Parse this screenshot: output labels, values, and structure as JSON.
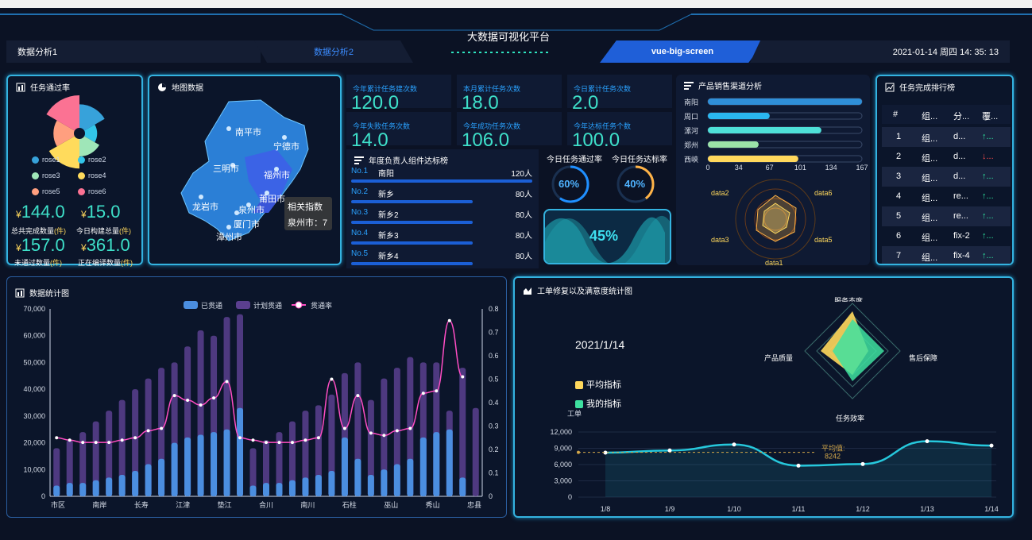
{
  "header": {
    "title": "大数据可视化平台",
    "tabs": [
      "数据分析1",
      "数据分析2",
      "vue-big-screen"
    ],
    "datetime": "2021-01-14 周四 14: 35: 13"
  },
  "task_pass": {
    "title": "任务通过率",
    "legend": [
      "rose1",
      "rose2",
      "rose3",
      "rose4",
      "rose5",
      "rose6"
    ],
    "legend_colors": [
      "#37a2da",
      "#32c5e9",
      "#9fe6b8",
      "#ffdb5c",
      "#ff9f7f",
      "#fb7293"
    ],
    "rose_values": [
      30,
      15,
      22,
      38,
      26,
      42
    ],
    "items": [
      {
        "value": "144.0",
        "label": "总共完成数量",
        "unit": "(件)"
      },
      {
        "value": "15.0",
        "label": "今日构建总量",
        "unit": "(件)"
      },
      {
        "value": "157.0",
        "label": "未通过数量",
        "unit": "(件)"
      },
      {
        "value": "361.0",
        "label": "正在编译数量",
        "unit": "(件)"
      }
    ],
    "currency": "¥"
  },
  "map": {
    "title": "地图数据",
    "cities": [
      "南平市",
      "宁德市",
      "三明市",
      "福州市",
      "莆田市",
      "龙岩市",
      "泉州市",
      "厦门市",
      "漳州市"
    ],
    "tooltip_title": "相关指数",
    "tooltip_value": "泉州市：7"
  },
  "stats": [
    {
      "label": "今年累计任务建次数",
      "value": "120.0"
    },
    {
      "label": "本月累计任务次数",
      "value": "18.0"
    },
    {
      "label": "今日累计任务次数",
      "value": "2.0"
    },
    {
      "label": "今年失败任务次数",
      "value": "14.0"
    },
    {
      "label": "今年成功任务次数",
      "value": "106.0"
    },
    {
      "label": "今年达标任务个数",
      "value": "100.0"
    }
  ],
  "ranking": {
    "title": "年度负责人组件达标榜",
    "rows": [
      {
        "no": "No.1",
        "name": "南阳",
        "count": "120人",
        "ratio": 1.0
      },
      {
        "no": "No.2",
        "name": "新乡",
        "count": "80人",
        "ratio": 0.67
      },
      {
        "no": "No.3",
        "name": "新乡2",
        "count": "80人",
        "ratio": 0.67
      },
      {
        "no": "No.4",
        "name": "新乡3",
        "count": "80人",
        "ratio": 0.67
      },
      {
        "no": "No.5",
        "name": "新乡4",
        "count": "80人",
        "ratio": 0.67
      }
    ]
  },
  "rates": {
    "pass_label": "今日任务通过率",
    "pass_value": "60%",
    "pass_fraction": 0.6,
    "reach_label": "今日任务达标率",
    "reach_value": "40%",
    "reach_fraction": 0.4,
    "wave_value": "45%",
    "wave_fraction": 0.45
  },
  "channel": {
    "title": "产品销售渠道分析",
    "bars": [
      {
        "name": "南阳",
        "value": 167,
        "color": "#2f8fd8"
      },
      {
        "name": "周口",
        "value": 67,
        "color": "#2ab7f0"
      },
      {
        "name": "漯河",
        "value": 123,
        "color": "#4ee0d8"
      },
      {
        "name": "郑州",
        "value": 55,
        "color": "#9be3a8"
      },
      {
        "name": "西峡",
        "value": 98,
        "color": "#ffd85c"
      }
    ],
    "ticks": [
      "0",
      "34",
      "67",
      "101",
      "134",
      "167"
    ],
    "radar_labels": [
      "data2",
      "data6",
      "data3",
      "data5",
      "data1"
    ]
  },
  "ranking_table": {
    "title": "任务完成排行榜",
    "headers": [
      "#",
      "组...",
      "分...",
      "覆..."
    ],
    "rows": [
      {
        "no": "1",
        "group": "组...",
        "branch": "d...",
        "dir": "↑..."
      },
      {
        "no": "2",
        "group": "组...",
        "branch": "d...",
        "dir": "↓..."
      },
      {
        "no": "3",
        "group": "组...",
        "branch": "d...",
        "dir": "↑..."
      },
      {
        "no": "4",
        "group": "组...",
        "branch": "re...",
        "dir": "↑..."
      },
      {
        "no": "5",
        "group": "组...",
        "branch": "re...",
        "dir": "↑..."
      },
      {
        "no": "6",
        "group": "组...",
        "branch": "fix-2",
        "dir": "↑..."
      },
      {
        "no": "7",
        "group": "组...",
        "branch": "fix-4",
        "dir": "↑..."
      }
    ]
  },
  "stats_chart": {
    "title": "数据统计图",
    "chart_data": {
      "type": "bar",
      "legend": [
        "已贯通",
        "计划贯通",
        "贯通率"
      ],
      "x_labels": [
        "市区",
        "南岸",
        "长寿",
        "江津",
        "垫江",
        "合川",
        "南川",
        "石柱",
        "巫山",
        "秀山",
        "忠县"
      ],
      "y_left_ticks": [
        "0",
        "10,000",
        "20,000",
        "30,000",
        "40,000",
        "50,000",
        "60,000",
        "70,000"
      ],
      "y_right_ticks": [
        "0",
        "0.1",
        "0.2",
        "0.3",
        "0.4",
        "0.5",
        "0.6",
        "0.7",
        "0.8"
      ],
      "ylim_left": [
        0,
        70000
      ],
      "ylim_right": [
        0,
        0.8
      ],
      "series": [
        {
          "name": "已贯通",
          "type": "bar",
          "values": [
            4000,
            5000,
            5000,
            6000,
            7000,
            8000,
            9500,
            12000,
            14000,
            20000,
            22000,
            23000,
            24000,
            25000,
            33000,
            4000,
            5000,
            5000,
            6000,
            7000,
            8000,
            9500,
            22000,
            14000,
            8000,
            10000,
            12000,
            14000,
            22000,
            24000,
            25000,
            7000
          ]
        },
        {
          "name": "计划贯通",
          "type": "bar",
          "values": [
            18000,
            21000,
            24000,
            28000,
            32000,
            36000,
            40000,
            44000,
            48000,
            50000,
            56000,
            62000,
            60000,
            67000,
            68000,
            18000,
            21000,
            24000,
            28000,
            32000,
            34000,
            38000,
            46000,
            50000,
            36000,
            44000,
            48000,
            52000,
            50000,
            50000,
            32000,
            48000,
            33000
          ]
        },
        {
          "name": "贯通率",
          "type": "line",
          "values": [
            0.25,
            0.24,
            0.23,
            0.23,
            0.23,
            0.24,
            0.25,
            0.28,
            0.29,
            0.43,
            0.41,
            0.39,
            0.42,
            0.49,
            0.25,
            0.24,
            0.23,
            0.23,
            0.23,
            0.24,
            0.25,
            0.5,
            0.29,
            0.43,
            0.27,
            0.26,
            0.28,
            0.29,
            0.44,
            0.45,
            0.75,
            0.51
          ]
        }
      ]
    }
  },
  "workorder": {
    "title": "工单修复以及满意度统计图",
    "date": "2021/1/14",
    "legend": [
      "平均指标",
      "我的指标"
    ],
    "radar_labels": [
      "服务态度",
      "产品质量",
      "售后保障",
      "任务效率"
    ],
    "chart_data": {
      "type": "line",
      "ylabel": "工单",
      "x": [
        "1/8",
        "1/9",
        "1/10",
        "1/11",
        "1/12",
        "1/13",
        "1/14"
      ],
      "values": [
        8200,
        8600,
        9700,
        5800,
        6100,
        10300,
        9500
      ],
      "y_ticks": [
        "0",
        "3,000",
        "6,000",
        "9,000",
        "12,000"
      ],
      "ylim": [
        0,
        12000
      ],
      "mark_label": "平均值:",
      "mark_value": "8242"
    }
  }
}
